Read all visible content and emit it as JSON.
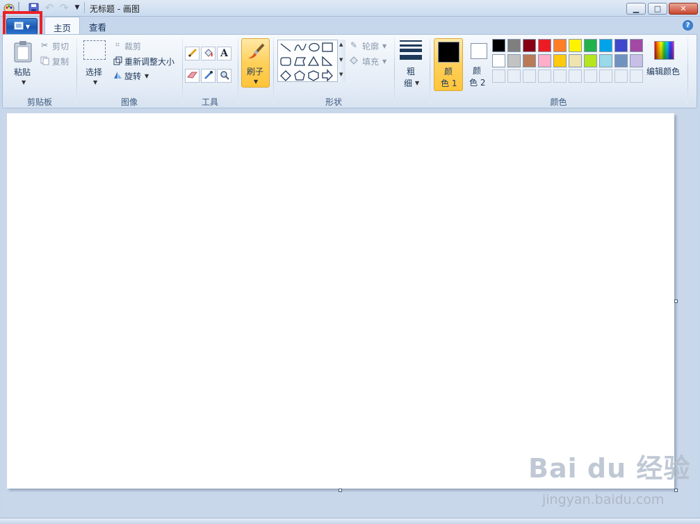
{
  "window": {
    "title": "无标题 - 画图",
    "minimize": "▁",
    "maximize": "□",
    "close": "✕"
  },
  "tabs": [
    {
      "label": "主页",
      "active": true
    },
    {
      "label": "查看",
      "active": false
    }
  ],
  "help": "?",
  "ribbon": {
    "clipboard": {
      "group": "剪贴板",
      "paste": "粘贴",
      "cut": "剪切",
      "copy": "复制"
    },
    "image": {
      "group": "图像",
      "select": "选择",
      "crop": "裁剪",
      "resize": "重新调整大小",
      "rotate": "旋转"
    },
    "tools": {
      "group": "工具"
    },
    "brushes": {
      "label": "刷子"
    },
    "shapes": {
      "group": "形状",
      "outline": "轮廓",
      "fill": "填充"
    },
    "size": {
      "label_line1": "粗",
      "label_line2": "细"
    },
    "colors": {
      "group": "颜色",
      "color1_line1": "颜",
      "color1_line2": "色 1",
      "color2_line1": "颜",
      "color2_line2": "色 2",
      "edit_colors": "编辑颜色",
      "color1_value": "#000000",
      "color2_value": "#ffffff",
      "palette_row1": [
        "#000000",
        "#7f7f7f",
        "#880015",
        "#ed1c24",
        "#ff7f27",
        "#fff200",
        "#22b14c",
        "#00a2e8",
        "#3f48cc",
        "#a349a4"
      ],
      "palette_row2": [
        "#ffffff",
        "#c3c3c3",
        "#b97a57",
        "#ffaec9",
        "#ffc90e",
        "#efe4b0",
        "#b5e61d",
        "#99d9ea",
        "#7092be",
        "#c8bfe7"
      ]
    }
  },
  "watermark": {
    "logo": "Bai du 经验",
    "url": "jingyan.baidu.com"
  }
}
